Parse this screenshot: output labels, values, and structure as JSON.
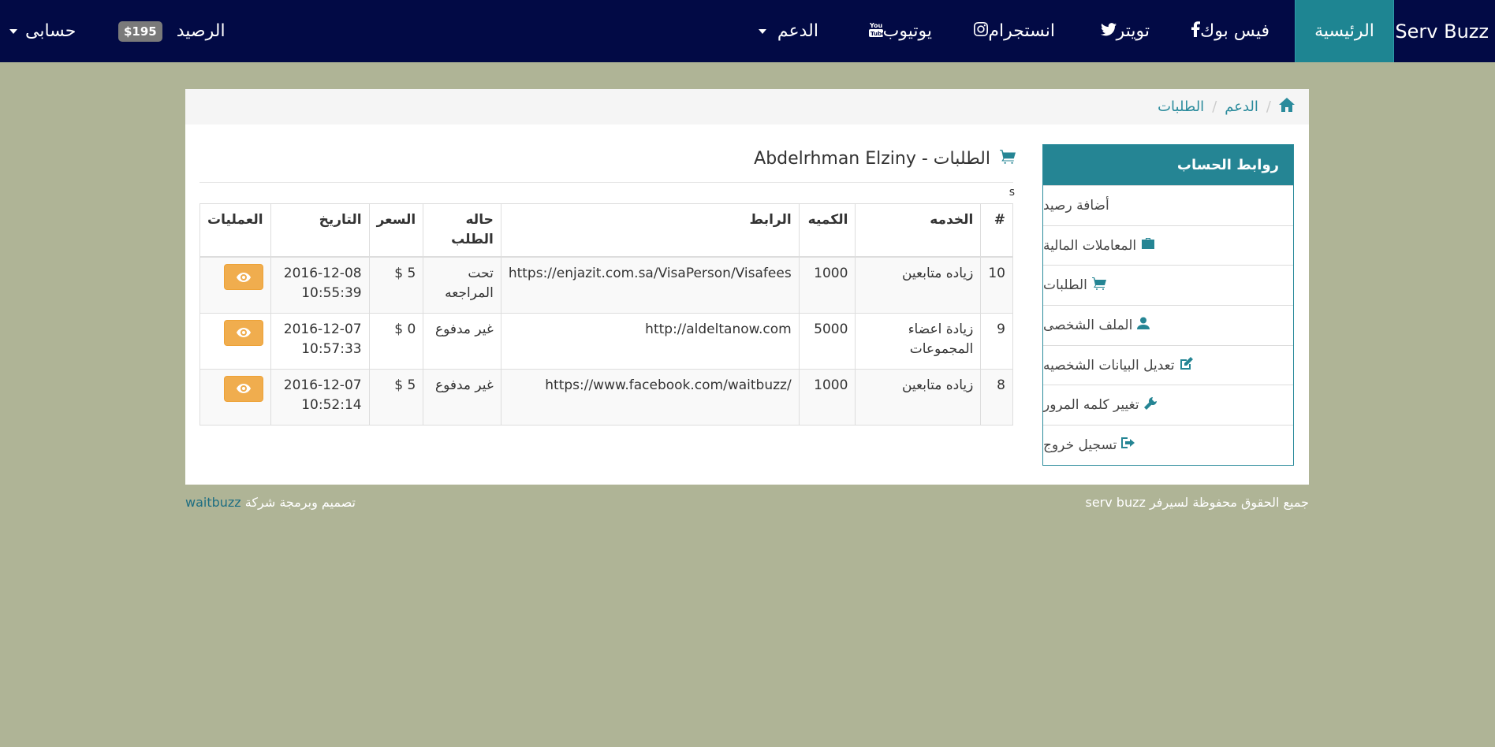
{
  "navbar": {
    "brand": "Serv Buzz",
    "home": "الرئيسية",
    "facebook": "فيس بوك",
    "twitter": "تويتر",
    "instagram": "انستجرام",
    "youtube": "يوتيوب",
    "support": "الدعم",
    "balance_label": "الرصيد",
    "balance_value": "$195",
    "account": "حسابى"
  },
  "breadcrumb": [
    "الدعم",
    "الطلبات"
  ],
  "sidebar": {
    "header": "روابط الحساب",
    "items": [
      {
        "label": "أضافة رصيد",
        "icon": "dollar-icon"
      },
      {
        "label": "المعاملات المالية",
        "icon": "briefcase-icon"
      },
      {
        "label": "الطلبات",
        "icon": "cart-icon"
      },
      {
        "label": "الملف الشخصى",
        "icon": "user-icon"
      },
      {
        "label": "تعديل البيانات الشخصيه",
        "icon": "edit-icon"
      },
      {
        "label": "تغيير كلمه المرور",
        "icon": "wrench-icon"
      },
      {
        "label": "تسجيل خروج",
        "icon": "signout-icon"
      }
    ]
  },
  "main": {
    "title": "الطلبات - Abdelrhman Elziny",
    "stray_text": "s",
    "table": {
      "headers": [
        "#",
        "الخدمه",
        "الكميه",
        "الرابط",
        "حاله الطلب",
        "السعر",
        "التاريخ",
        "العمليات"
      ],
      "rows": [
        {
          "id": "10",
          "service": "زياده متابعين",
          "qty": "1000",
          "link": "https://enjazit.com.sa/VisaPerson/Visafees",
          "status": "تحت المراجعه",
          "price": "5 $",
          "date": "2016-12-08 10:55:39"
        },
        {
          "id": "9",
          "service": "زيادة اعضاء المجموعات",
          "qty": "5000",
          "link": "http://aldeltanow.com",
          "status": "غير مدفوع",
          "price": "0 $",
          "date": "2016-12-07 10:57:33"
        },
        {
          "id": "8",
          "service": "زياده متابعين",
          "qty": "1000",
          "link": "https://www.facebook.com/waitbuzz/",
          "status": "غير مدفوع",
          "price": "5 $",
          "date": "2016-12-07 10:52:14"
        }
      ]
    }
  },
  "footer": {
    "rights": "جميع الحقوق محفوظة لسيرفر serv buzz",
    "design_prefix": "تصميم وبرمجة شركة",
    "company": "waitbuzz"
  },
  "colors": {
    "navbar_bg": "#020a45",
    "accent": "#258594",
    "page_bg": "#afb496",
    "view_button": "#f0ad4e",
    "badge": "#7a7a7a"
  }
}
